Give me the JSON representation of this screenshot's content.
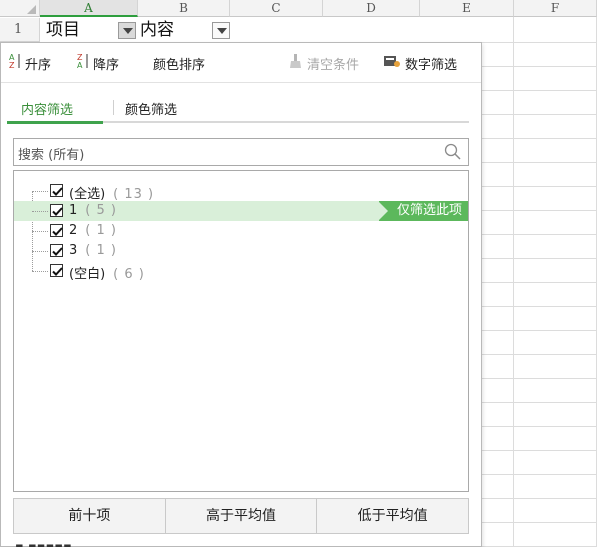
{
  "sheet": {
    "columns": [
      "A",
      "B",
      "C",
      "D",
      "E",
      "F"
    ],
    "active_column": "A",
    "rows": [
      "1"
    ],
    "cells": {
      "a1": "项目",
      "b1": "内容"
    }
  },
  "toolbar": {
    "sort_asc": "升序",
    "sort_desc": "降序",
    "color_sort": "颜色排序",
    "clear_conditions": "清空条件",
    "number_filter": "数字筛选"
  },
  "tabs": {
    "content_filter": "内容筛选",
    "color_filter": "颜色筛选"
  },
  "search": {
    "placeholder": "搜索 (所有)"
  },
  "list": {
    "items": [
      {
        "label": "(全选)",
        "count": "( 13 )",
        "checked": true
      },
      {
        "label": "1",
        "count": "( 5 )",
        "checked": true
      },
      {
        "label": "2",
        "count": "( 1 )",
        "checked": true
      },
      {
        "label": "3",
        "count": "( 1 )",
        "checked": true
      },
      {
        "label": "(空白)",
        "count": "( 6 )",
        "checked": true
      }
    ],
    "only_filter_label": "仅筛选此项"
  },
  "footer": {
    "top10": "前十项",
    "above_avg": "高于平均值",
    "below_avg": "低于平均值"
  },
  "colors": {
    "accent": "#3fa34d",
    "highlight": "#d9efd9",
    "only_button": "#5cb85c"
  }
}
